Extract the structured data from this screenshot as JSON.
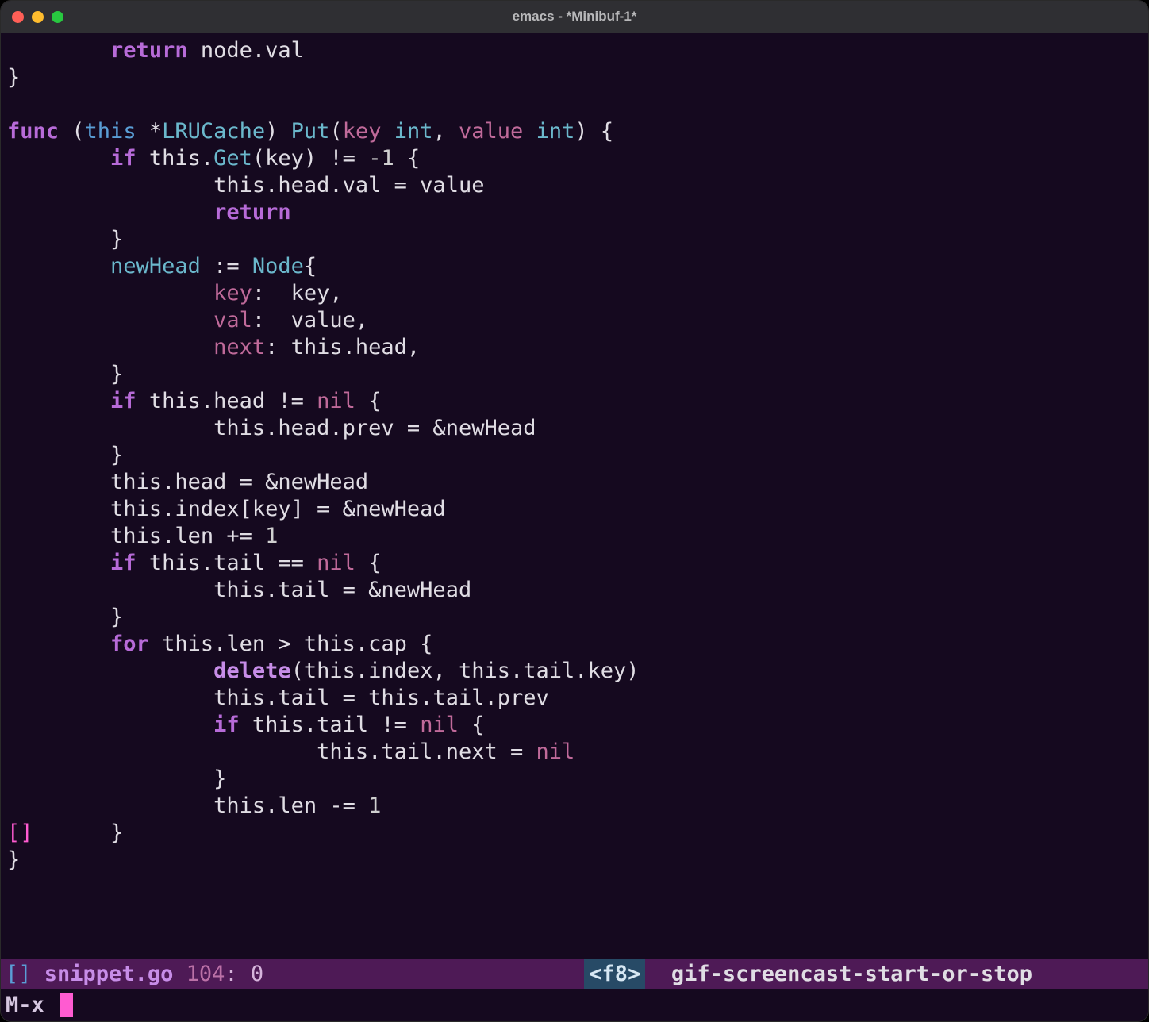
{
  "window": {
    "title": "emacs -  *Minibuf-1*"
  },
  "code": {
    "lines": [
      {
        "indent": "        ",
        "tokens": [
          {
            "t": "return ",
            "c": "kw"
          },
          {
            "t": "node.val",
            "c": "plain"
          }
        ]
      },
      {
        "indent": "",
        "tokens": [
          {
            "t": "}",
            "c": "plain"
          }
        ]
      },
      {
        "indent": "",
        "tokens": []
      },
      {
        "indent": "",
        "tokens": [
          {
            "t": "func ",
            "c": "kw"
          },
          {
            "t": "(",
            "c": "plain"
          },
          {
            "t": "this",
            "c": "this"
          },
          {
            "t": " *",
            "c": "plain"
          },
          {
            "t": "LRUCache",
            "c": "type"
          },
          {
            "t": ") ",
            "c": "plain"
          },
          {
            "t": "Put",
            "c": "fn"
          },
          {
            "t": "(",
            "c": "plain"
          },
          {
            "t": "key ",
            "c": "field"
          },
          {
            "t": "int",
            "c": "type"
          },
          {
            "t": ", ",
            "c": "plain"
          },
          {
            "t": "value ",
            "c": "field"
          },
          {
            "t": "int",
            "c": "type"
          },
          {
            "t": ") {",
            "c": "plain"
          }
        ]
      },
      {
        "indent": "        ",
        "tokens": [
          {
            "t": "if ",
            "c": "kw"
          },
          {
            "t": "this.",
            "c": "plain"
          },
          {
            "t": "Get",
            "c": "fn"
          },
          {
            "t": "(key) != ",
            "c": "plain"
          },
          {
            "t": "-1",
            "c": "num"
          },
          {
            "t": " {",
            "c": "plain"
          }
        ]
      },
      {
        "indent": "                ",
        "tokens": [
          {
            "t": "this.head.val = value",
            "c": "plain"
          }
        ]
      },
      {
        "indent": "                ",
        "tokens": [
          {
            "t": "return",
            "c": "kw"
          }
        ]
      },
      {
        "indent": "        ",
        "tokens": [
          {
            "t": "}",
            "c": "plain"
          }
        ]
      },
      {
        "indent": "        ",
        "tokens": [
          {
            "t": "newHead",
            "c": "var"
          },
          {
            "t": " := ",
            "c": "plain"
          },
          {
            "t": "Node",
            "c": "type"
          },
          {
            "t": "{",
            "c": "plain"
          }
        ]
      },
      {
        "indent": "                ",
        "tokens": [
          {
            "t": "key",
            "c": "field"
          },
          {
            "t": ":  key,",
            "c": "plain"
          }
        ]
      },
      {
        "indent": "                ",
        "tokens": [
          {
            "t": "val",
            "c": "field"
          },
          {
            "t": ":  value,",
            "c": "plain"
          }
        ]
      },
      {
        "indent": "                ",
        "tokens": [
          {
            "t": "next",
            "c": "field"
          },
          {
            "t": ": this.head,",
            "c": "plain"
          }
        ]
      },
      {
        "indent": "        ",
        "tokens": [
          {
            "t": "}",
            "c": "plain"
          }
        ]
      },
      {
        "indent": "        ",
        "tokens": [
          {
            "t": "if ",
            "c": "kw"
          },
          {
            "t": "this.head != ",
            "c": "plain"
          },
          {
            "t": "nil",
            "c": "nil"
          },
          {
            "t": " {",
            "c": "plain"
          }
        ]
      },
      {
        "indent": "                ",
        "tokens": [
          {
            "t": "this.head.prev = &newHead",
            "c": "plain"
          }
        ]
      },
      {
        "indent": "        ",
        "tokens": [
          {
            "t": "}",
            "c": "plain"
          }
        ]
      },
      {
        "indent": "        ",
        "tokens": [
          {
            "t": "this.head = &newHead",
            "c": "plain"
          }
        ]
      },
      {
        "indent": "        ",
        "tokens": [
          {
            "t": "this.index[key] = &newHead",
            "c": "plain"
          }
        ]
      },
      {
        "indent": "        ",
        "tokens": [
          {
            "t": "this.len += ",
            "c": "plain"
          },
          {
            "t": "1",
            "c": "num"
          }
        ]
      },
      {
        "indent": "        ",
        "tokens": [
          {
            "t": "if ",
            "c": "kw"
          },
          {
            "t": "this.tail == ",
            "c": "plain"
          },
          {
            "t": "nil",
            "c": "nil"
          },
          {
            "t": " {",
            "c": "plain"
          }
        ]
      },
      {
        "indent": "                ",
        "tokens": [
          {
            "t": "this.tail = &newHead",
            "c": "plain"
          }
        ]
      },
      {
        "indent": "        ",
        "tokens": [
          {
            "t": "}",
            "c": "plain"
          }
        ]
      },
      {
        "indent": "        ",
        "tokens": [
          {
            "t": "for ",
            "c": "kw"
          },
          {
            "t": "this.len > this.cap {",
            "c": "plain"
          }
        ]
      },
      {
        "indent": "                ",
        "tokens": [
          {
            "t": "delete",
            "c": "builtin"
          },
          {
            "t": "(this.index, this.tail.key)",
            "c": "plain"
          }
        ]
      },
      {
        "indent": "                ",
        "tokens": [
          {
            "t": "this.tail = this.tail.prev",
            "c": "plain"
          }
        ]
      },
      {
        "indent": "                ",
        "tokens": [
          {
            "t": "if ",
            "c": "kw"
          },
          {
            "t": "this.tail != ",
            "c": "plain"
          },
          {
            "t": "nil",
            "c": "nil"
          },
          {
            "t": " {",
            "c": "plain"
          }
        ]
      },
      {
        "indent": "                        ",
        "tokens": [
          {
            "t": "this.tail.next = ",
            "c": "plain"
          },
          {
            "t": "nil",
            "c": "nil"
          }
        ]
      },
      {
        "indent": "                ",
        "tokens": [
          {
            "t": "}",
            "c": "plain"
          }
        ]
      },
      {
        "indent": "                ",
        "tokens": [
          {
            "t": "this.len -= ",
            "c": "plain"
          },
          {
            "t": "1",
            "c": "num"
          }
        ]
      },
      {
        "indent": "",
        "tokens": [
          {
            "t": "[]",
            "c": "brace-hl"
          },
          {
            "t": "      }",
            "c": "plain"
          }
        ]
      },
      {
        "indent": "",
        "tokens": [
          {
            "t": "}",
            "c": "plain"
          }
        ]
      }
    ]
  },
  "modeline": {
    "brackets": "[]",
    "filename": "snippet.go",
    "line": "104",
    "col": "0",
    "key": "<f8>",
    "command": "gif-screencast-start-or-stop"
  },
  "minibuffer": {
    "prompt": "M-x "
  }
}
